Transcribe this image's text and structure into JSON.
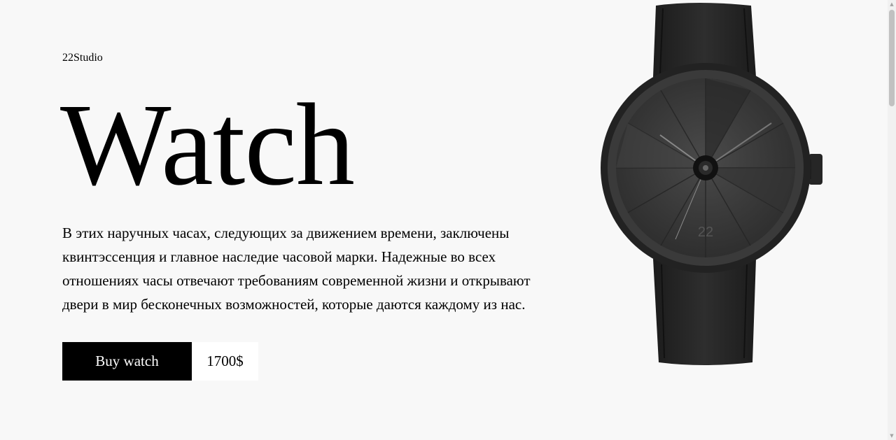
{
  "brand": "22Studio",
  "hero": {
    "title": "Watch",
    "description": "В этих наручных часах, следующих за движением времени, заключены квинтэссенция и главное наследие часовой марки. Надежные во всех отношениях часы отвечают требованиям современной жизни и открывают двери в мир бесконечных возможностей, которые даются каждому из нас.",
    "buy_label": "Buy watch",
    "price": "1700$"
  },
  "watch": {
    "dial_number": "22"
  },
  "colors": {
    "background": "#f8f8f8",
    "button_bg": "#000000",
    "button_text": "#ffffff",
    "price_bg": "#ffffff",
    "watch_body": "#2b2b2b"
  }
}
